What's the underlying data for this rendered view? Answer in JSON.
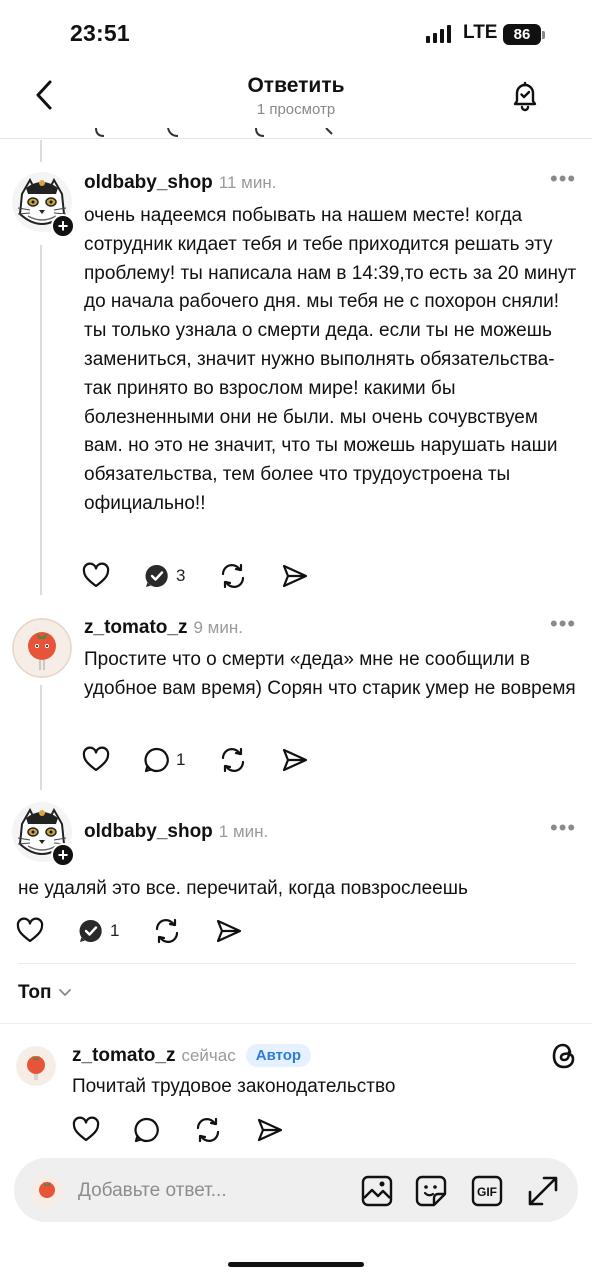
{
  "status_bar": {
    "time": "23:51",
    "network": "LTE",
    "battery": "86"
  },
  "header": {
    "title": "Ответить",
    "subtitle": "1 просмотр"
  },
  "comments": [
    {
      "username": "oldbaby_shop",
      "time": "11 мин.",
      "text": "очень надеемся побывать на нашем месте! когда сотрудник кидает тебя и тебе приходится решать эту проблему! ты написала нам в 14:39,то есть за 20 минут до начала рабочего дня. мы тебя не с похорон сняли! ты только узнала о смерти деда. если ты не можешь замениться, значит нужно выполнять обязательства- так принято во взрослом мире! какими бы болезненными они не были. мы очень сочувствуем вам. но это не значит, что ты можешь нарушать наши обязательства, тем более что трудоустроена ты официально!!",
      "reply_count": "3"
    },
    {
      "username": "z_tomato_z",
      "time": "9 мин.",
      "text": "Простите что о смерти «деда» мне не сообщили в удобное вам время) Сорян что старик умер не вовремя",
      "reply_count": "1"
    },
    {
      "username": "oldbaby_shop",
      "time": "1 мин.",
      "text": "не удаляй это все. перечитай, когда повзрослеешь",
      "reply_count": "1"
    }
  ],
  "sort": {
    "label": "Топ"
  },
  "reply": {
    "username": "z_tomato_z",
    "time": "сейчас",
    "badge": "Автор",
    "text": "Почитай трудовое законодательство"
  },
  "composer": {
    "placeholder": "Добавьте ответ..."
  },
  "icons": {
    "back": "chevron-left-icon",
    "bell": "bell-icon",
    "like": "heart-icon",
    "reply_check": "check-bubble-icon",
    "comment": "comment-icon",
    "repost": "repost-icon",
    "share": "share-icon",
    "threads": "threads-logo-icon",
    "gallery": "image-icon",
    "sticker": "sticker-icon",
    "gif": "gif-icon",
    "expand": "expand-icon"
  }
}
